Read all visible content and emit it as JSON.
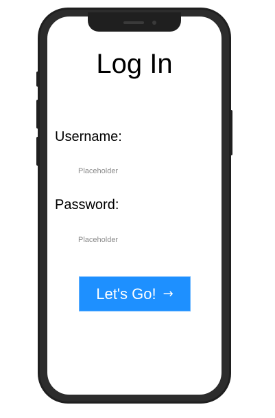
{
  "screen": {
    "title": "Log In"
  },
  "form": {
    "username_label": "Username:",
    "username_placeholder": "Placeholder",
    "username_value": "",
    "password_label": "Password:",
    "password_placeholder": "Placeholder",
    "password_value": ""
  },
  "submit": {
    "label": "Let's Go!",
    "icon": "arrow-right-icon",
    "glyph": "→",
    "color": "#1e90ff"
  },
  "device": {
    "frame_color": "#1f1f1f",
    "screen_color": "#ffffff"
  }
}
